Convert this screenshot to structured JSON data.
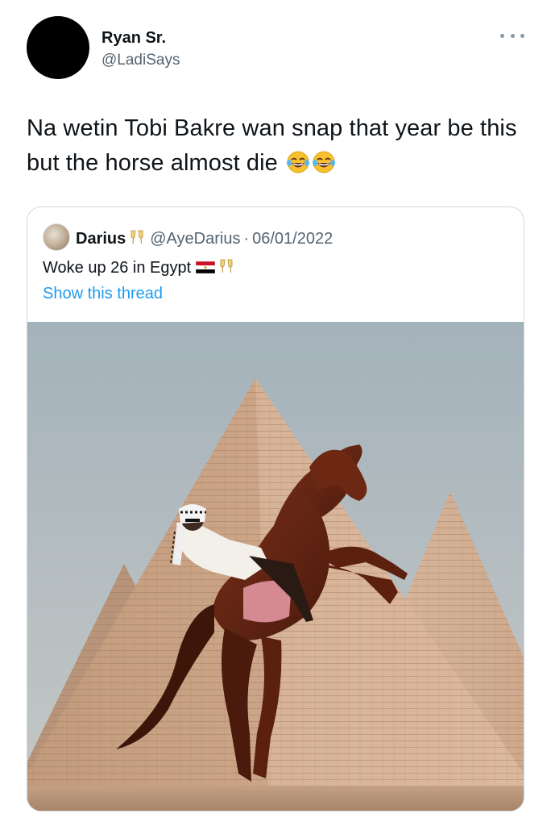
{
  "tweet": {
    "author_name": "Ryan Sr.",
    "author_handle": "@LadiSays",
    "text": "Na wetin Tobi Bakre wan snap that year be this but the horse almost die",
    "emojis": [
      "face-with-tears-of-joy",
      "face-with-tears-of-joy"
    ]
  },
  "quoted": {
    "name": "Darius",
    "handle": "@AyeDarius",
    "separator": "·",
    "date": "06/01/2022",
    "text": "Woke up 26 in Egypt",
    "show_thread": "Show this thread",
    "icons": [
      "clinking-glasses-icon",
      "egypt-flag-icon"
    ]
  },
  "colors": {
    "text_primary": "#0f1419",
    "text_secondary": "#536471",
    "link": "#1d9bf0",
    "border": "#cfd9de"
  }
}
